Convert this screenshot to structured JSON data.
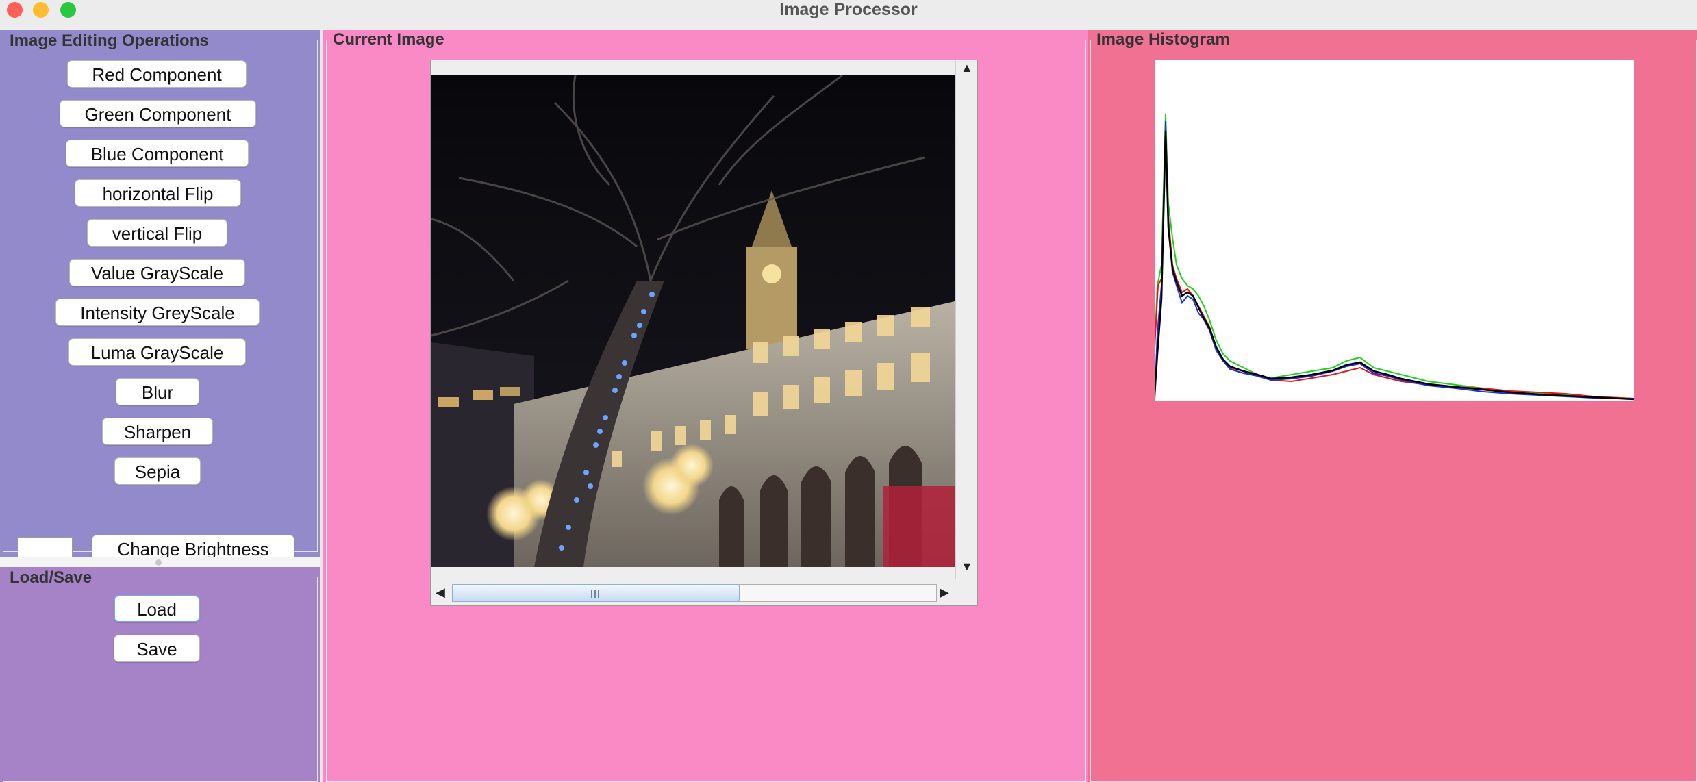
{
  "window": {
    "title": "Image Processor"
  },
  "panels": {
    "operations": {
      "title": "Image Editing Operations"
    },
    "load_save": {
      "title": "Load/Save"
    },
    "current_image": {
      "title": "Current Image"
    },
    "histogram": {
      "title": "Image Histogram"
    }
  },
  "operations": {
    "red_component": "Red Component",
    "green_component": "Green Component",
    "blue_component": "Blue Component",
    "horizontal_flip": "horizontal Flip",
    "vertical_flip": "vertical Flip",
    "value_grayscale": "Value GrayScale",
    "intensity_greyscale": "Intensity GreyScale",
    "luma_grayscale": "Luma GrayScale",
    "blur": "Blur",
    "sharpen": "Sharpen",
    "sepia": "Sepia",
    "change_brightness": "Change Brightness",
    "brightness_value": ""
  },
  "load_save": {
    "load": "Load",
    "save": "Save"
  },
  "colors": {
    "operations_bg": "#938acb",
    "load_save_bg": "#a683c6",
    "current_image_bg": "#fa8ac6",
    "histogram_bg": "#f07191",
    "focus_ring": "#79a6e8"
  },
  "image": {
    "subject": "night-street-photo",
    "horizontal_scroll_fraction": 0.55
  }
}
